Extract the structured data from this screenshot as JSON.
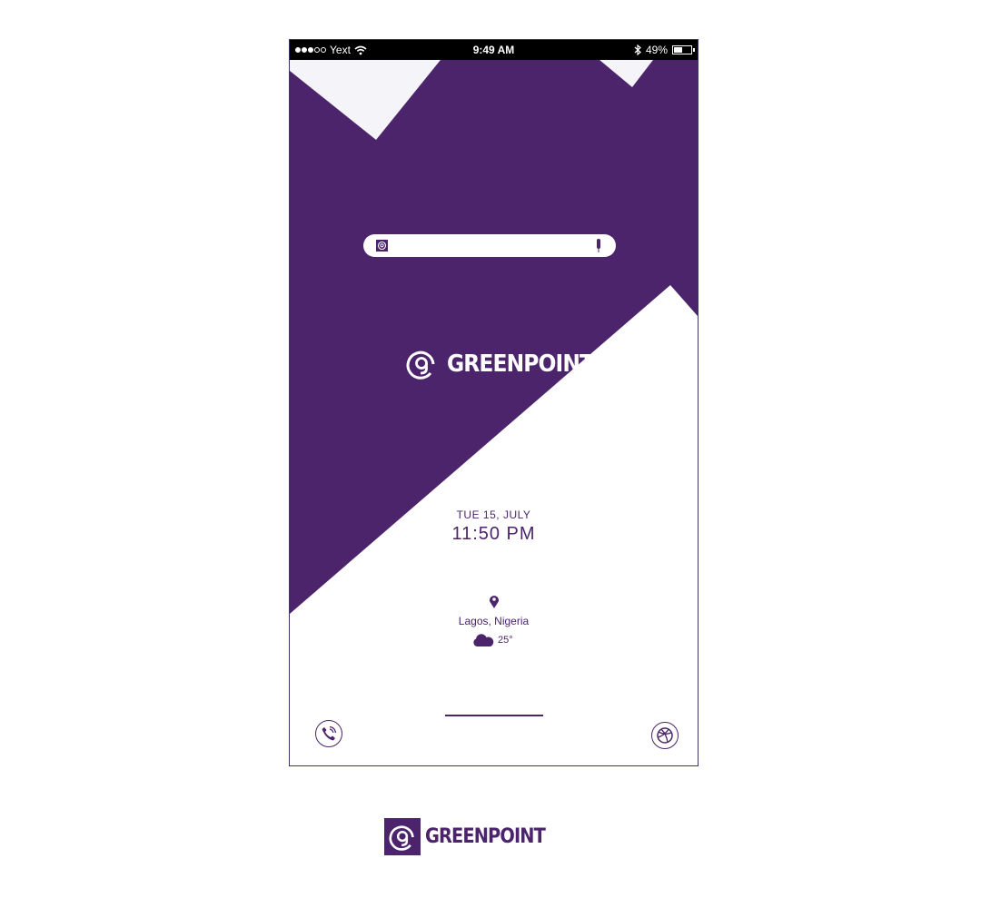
{
  "colors": {
    "brand_purple": "#4b246b",
    "light_gray": "#f5f4f8",
    "white": "#ffffff"
  },
  "statusbar": {
    "carrier": "Yext",
    "time": "9:49 AM",
    "battery_percent": "49%",
    "battery_level": 0.49,
    "signal_bars_filled": 3,
    "signal_bars_total": 5,
    "icons": [
      "wifi-icon",
      "bluetooth-icon",
      "battery-icon"
    ]
  },
  "search": {
    "logo_icon": "greenpoint-logo-icon",
    "mic_icon": "microphone-icon"
  },
  "brand": {
    "name": "GREENPOINT",
    "logo_icon": "greenpoint-logo-icon"
  },
  "datetime": {
    "date": "TUE 15, JULY",
    "time": "11:50 PM"
  },
  "location": {
    "icon": "map-pin-icon",
    "city": "Lagos, Nigeria"
  },
  "weather": {
    "icon": "cloud-icon",
    "temperature": "25°"
  },
  "dock": {
    "left_icon": "phone-call-icon",
    "right_icon": "dribbble-icon"
  },
  "footer": {
    "brand_name": "GREENPOINT"
  }
}
